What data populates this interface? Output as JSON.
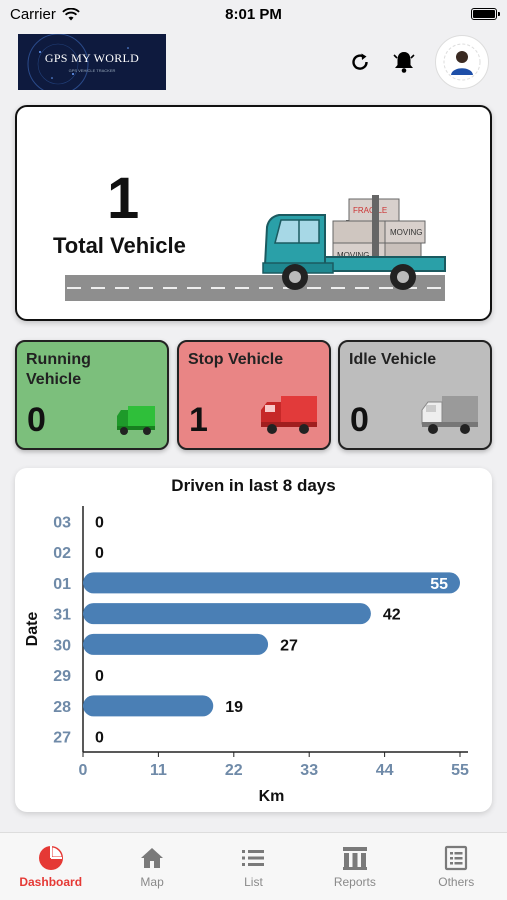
{
  "status_bar": {
    "carrier": "Carrier",
    "time": "8:01 PM"
  },
  "header": {
    "logo_title": "GPS MY WORLD",
    "logo_subtitle": "GPS VEHICLE TRACKER",
    "icons": [
      "refresh-icon",
      "bell-icon",
      "avatar"
    ]
  },
  "total": {
    "count": "1",
    "label": "Total Vehicle",
    "illustration_box_labels": [
      "FRAGILE",
      "MOVING",
      "MOVING"
    ]
  },
  "status_cards": [
    {
      "label": "Running Vehicle",
      "count": "0",
      "color": "#7cbf7c",
      "icon_color": "#2fbf3a"
    },
    {
      "label": "Stop Vehicle",
      "count": "1",
      "color": "#e98585",
      "icon_color": "#e23a3a"
    },
    {
      "label": "Idle Vehicle",
      "count": "0",
      "color": "#bdbdbd",
      "icon_color": "#9a9a9a"
    }
  ],
  "chart_data": {
    "type": "bar",
    "orientation": "horizontal",
    "title": "Driven in last 8 days",
    "xlabel": "Km",
    "ylabel": "Date",
    "categories": [
      "03",
      "02",
      "01",
      "31",
      "30",
      "29",
      "28",
      "27"
    ],
    "values": [
      0,
      0,
      55,
      42,
      27,
      0,
      19,
      0
    ],
    "xlim": [
      0,
      55
    ],
    "xticks": [
      "0",
      "11",
      "22",
      "33",
      "44",
      "55"
    ],
    "bar_color": "#4a7fb5",
    "tick_color": "#6f8aa8",
    "grid": false
  },
  "bottom_nav": [
    {
      "label": "Dashboard",
      "icon": "pie-chart-icon",
      "active": true
    },
    {
      "label": "Map",
      "icon": "home-icon",
      "active": false
    },
    {
      "label": "List",
      "icon": "list-icon",
      "active": false
    },
    {
      "label": "Reports",
      "icon": "columns-icon",
      "active": false
    },
    {
      "label": "Others",
      "icon": "clipboard-icon",
      "active": false
    }
  ]
}
